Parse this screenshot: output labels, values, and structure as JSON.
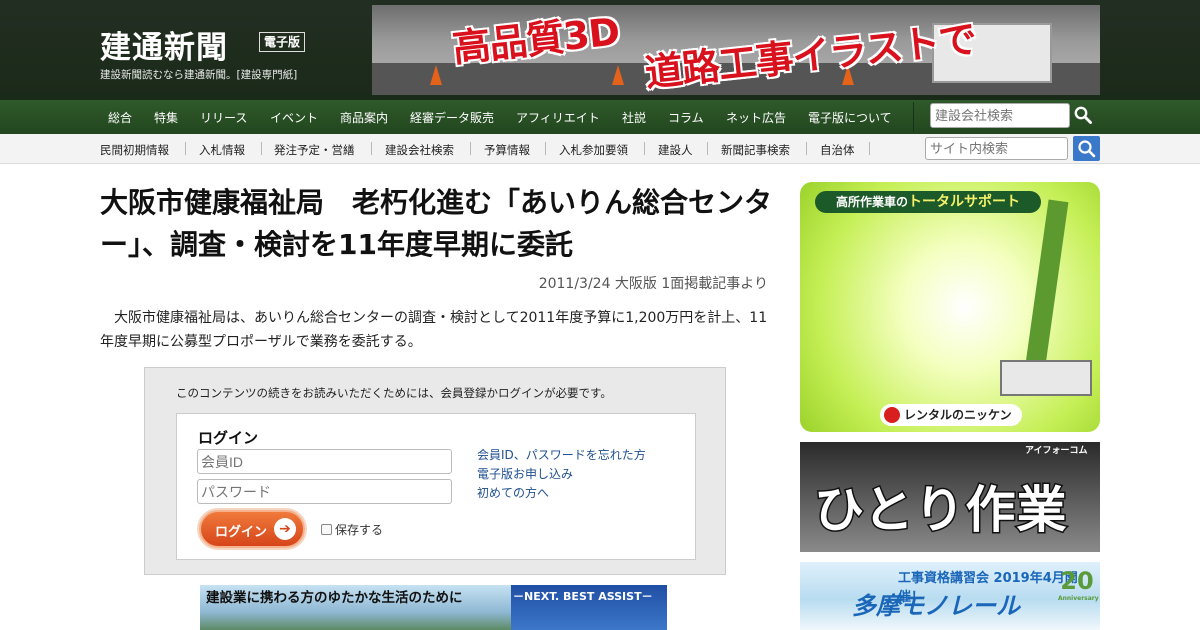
{
  "site": {
    "logo_text": "建通新聞",
    "edition_badge": "電子版",
    "tagline": "建設新聞読むなら建通新聞。[建設専門紙]"
  },
  "top_banner": {
    "line1": "高品質3D",
    "line2": "道路工事イラストで"
  },
  "main_nav": {
    "items": [
      "総合",
      "特集",
      "リリース",
      "イベント",
      "商品案内",
      "経審データ販売",
      "アフィリエイト",
      "社説",
      "コラム",
      "ネット広告",
      "電子版について"
    ],
    "search_placeholder": "建設会社検索"
  },
  "sub_nav": {
    "items": [
      "民間初期情報",
      "入札情報",
      "発注予定・営繕",
      "建設会社検索",
      "予算情報",
      "入札参加要領",
      "建設人",
      "新聞記事検索",
      "自治体"
    ],
    "search_placeholder": "サイト内検索"
  },
  "article": {
    "title": "大阪市健康福祉局　老朽化進む「あいりん総合センター」、調査・検討を11年度早期に委託",
    "dateline": "2011/3/24 大阪版 1面掲載記事より",
    "lead": "大阪市健康福祉局は、あいりん総合センターの調査・検討として2011年度予算に1,200万円を計上、11年度早期に公募型プロポーザルで業務を委託する。"
  },
  "login": {
    "notice": "このコンテンツの続きをお読みいただくためには、会員登録かログインが必要です。",
    "title": "ログイン",
    "id_placeholder": "会員ID",
    "password_placeholder": "パスワード",
    "button_label": "ログイン",
    "remember_label": "保存する",
    "links": [
      "会員ID、パスワードを忘れた方",
      "電子版お申し込み",
      "初めての方へ"
    ]
  },
  "bottom_banner": {
    "left_text": "建設業に携わる方のゆたかな生活のために",
    "right_text": "－NEXT. BEST ASSIST－"
  },
  "side_ads": {
    "ad1_header_prefix": "高所作業車の",
    "ad1_header_highlight": "トータルサポート",
    "ad1_footer": "レンタルのニッケン",
    "ad2_brand": "アイフォーコム",
    "ad2_text": "ひとり作業",
    "ad3_line1": "工事資格講習会 2019年4月開催！",
    "ad3_line2": "多摩モノレール",
    "ad3_badge": "20",
    "ad3_badge_sub": "Anniversary"
  },
  "colors": {
    "header_bg": "#1f2c1e",
    "nav_green": "#2a5226",
    "search_button": "#3a79c9",
    "login_orange": "#e5591f",
    "link_blue": "#1f4f8f"
  }
}
